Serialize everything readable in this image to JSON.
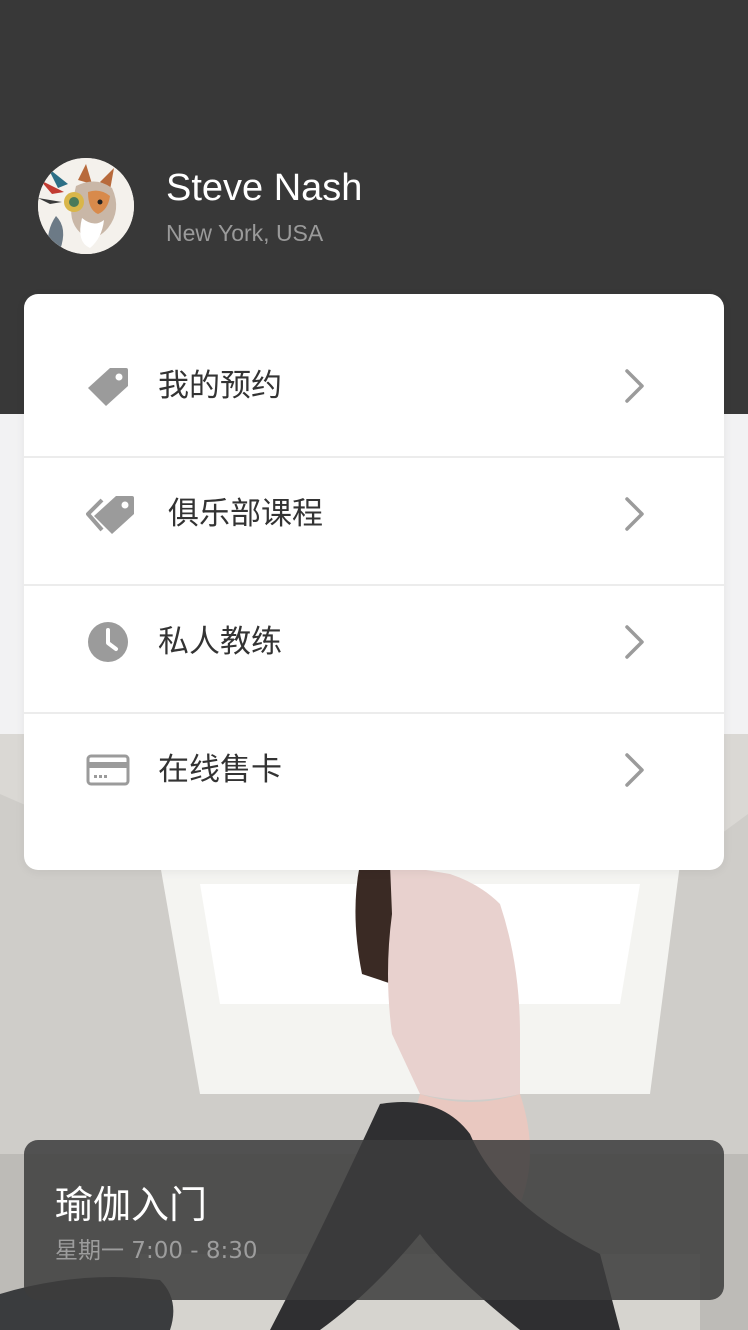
{
  "profile": {
    "name": "Steve Nash",
    "location": "New York, USA",
    "avatar_icon": "fox-avatar"
  },
  "menu": {
    "items": [
      {
        "label": "我的预约",
        "icon": "tag-icon"
      },
      {
        "label": "俱乐部课程",
        "icon": "tags-icon"
      },
      {
        "label": "私人教练",
        "icon": "clock-icon"
      },
      {
        "label": "在线售卡",
        "icon": "credit-card-icon"
      }
    ],
    "chevron_icon": "chevron-right-icon"
  },
  "class_card": {
    "title": "瑜伽入门",
    "time": "星期一 7:00 - 8:30"
  },
  "colors": {
    "header_bg": "#383838",
    "page_bg": "#f2f2f3",
    "icon_gray": "#9b9b9b",
    "text_dark": "#333333"
  }
}
